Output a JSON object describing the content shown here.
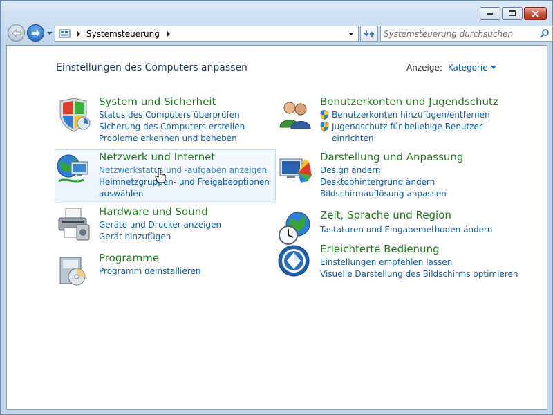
{
  "window": {
    "controls": {
      "minimize": "minimize",
      "maximize": "maximize",
      "close": "close"
    }
  },
  "address_bar": {
    "breadcrumb": "Systemsteuerung"
  },
  "search": {
    "placeholder": "Systemsteuerung durchsuchen"
  },
  "main": {
    "title": "Einstellungen des Computers anpassen",
    "view_label": "Anzeige:",
    "view_value": "Kategorie"
  },
  "categories": [
    {
      "title": "System und Sicherheit",
      "links": [
        "Status des Computers überprüfen",
        "Sicherung des Computers erstellen",
        "Probleme erkennen und beheben"
      ]
    },
    {
      "title": "Netzwerk und Internet",
      "links": [
        "Netzwerkstatus und -aufgaben anzeigen",
        "Heimnetzgruppen- und Freigabeoptionen",
        "auswählen"
      ]
    },
    {
      "title": "Hardware und Sound",
      "links": [
        "Geräte und Drucker anzeigen",
        "Gerät hinzufügen"
      ]
    },
    {
      "title": "Programme",
      "links": [
        "Programm deinstallieren"
      ]
    },
    {
      "title": "Benutzerkonten und Jugendschutz",
      "links": [
        "Benutzerkonten hinzufügen/entfernen",
        "Jugendschutz für beliebige Benutzer",
        "einrichten"
      ]
    },
    {
      "title": "Darstellung und Anpassung",
      "links": [
        "Design ändern",
        "Desktophintergrund ändern",
        "Bildschirmauflösung anpassen"
      ]
    },
    {
      "title": "Zeit, Sprache und Region",
      "links": [
        "Tastaturen und Eingabemethoden ändern"
      ]
    },
    {
      "title": "Erleichterte Bedienung",
      "links": [
        "Einstellungen empfehlen lassen",
        "Visuelle Darstellung des Bildschirms optimieren"
      ]
    }
  ],
  "colors": {
    "category_title": "#1e7b1e",
    "link": "#0d5eb5",
    "heading": "#1e395b"
  }
}
